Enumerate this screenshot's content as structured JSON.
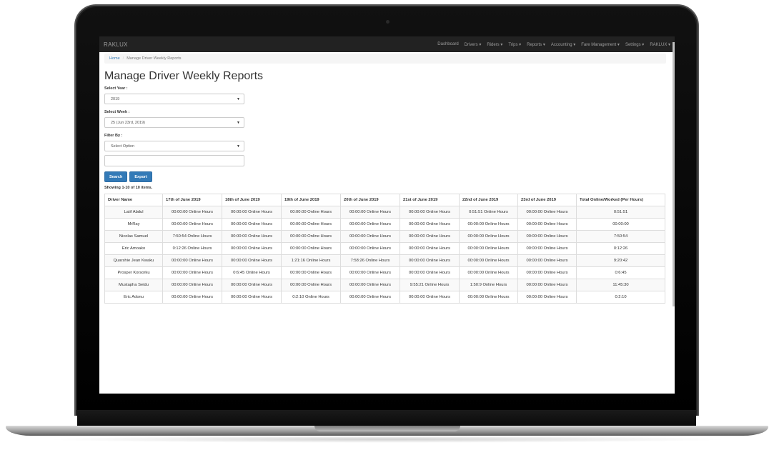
{
  "navbar": {
    "brand": "RAKLUX",
    "items": [
      "Dashboard",
      "Drivers ▾",
      "Riders ▾",
      "Trips ▾",
      "Reports ▾",
      "Accounting ▾",
      "Fare Management ▾",
      "Settings ▾",
      "RAKLUX ▾"
    ]
  },
  "breadcrumb": {
    "home": "Home",
    "separator": "/",
    "current": "Manage Driver Weekly Reports"
  },
  "page": {
    "title": "Manage Driver Weekly Reports"
  },
  "form": {
    "year_label": "Select Year :",
    "year_value": "2019",
    "week_label": "Select Week :",
    "week_value": "25 (Jun 23rd, 2019)",
    "filter_label": "Filter By :",
    "filter_value": "Select Option",
    "search_button": "Search",
    "export_button": "Export"
  },
  "summary": "Showing 1-10 of 10 items.",
  "table": {
    "headers": [
      "Driver Name",
      "17th of June 2019",
      "18th of June 2019",
      "19th of June 2019",
      "20th of June 2019",
      "21st of June 2019",
      "22nd of June 2019",
      "23rd of June 2019",
      "Total Online/Worked (Per Hours)"
    ],
    "rows": [
      [
        "Latif Abdul",
        "00:00:00 Online Hours",
        "00:00:00 Online Hours",
        "00:00:00 Online Hours",
        "00:00:00 Online Hours",
        "00:00:00 Online Hours",
        "0:51:51 Online Hours",
        "00:00:00 Online Hours",
        "0:51:51"
      ],
      [
        "MrRay",
        "00:00:00 Online Hours",
        "00:00:00 Online Hours",
        "00:00:00 Online Hours",
        "00:00:00 Online Hours",
        "00:00:00 Online Hours",
        "00:00:00 Online Hours",
        "00:00:00 Online Hours",
        "00:00:00"
      ],
      [
        "Nicolas Samuel",
        "7:50:54 Online Hours",
        "00:00:00 Online Hours",
        "00:00:00 Online Hours",
        "00:00:00 Online Hours",
        "00:00:00 Online Hours",
        "00:00:00 Online Hours",
        "00:00:00 Online Hours",
        "7:50:54"
      ],
      [
        "Eric Amoako",
        "0:12:26 Online Hours",
        "00:00:00 Online Hours",
        "00:00:00 Online Hours",
        "00:00:00 Online Hours",
        "00:00:00 Online Hours",
        "00:00:00 Online Hours",
        "00:00:00 Online Hours",
        "0:12:26"
      ],
      [
        "Quarshie Jean Kwaku",
        "00:00:00 Online Hours",
        "00:00:00 Online Hours",
        "1:21:16 Online Hours",
        "7:58:26 Online Hours",
        "00:00:00 Online Hours",
        "00:00:00 Online Hours",
        "00:00:00 Online Hours",
        "9:20:42"
      ],
      [
        "Prosper Korsorku",
        "00:00:00 Online Hours",
        "0:6:45 Online Hours",
        "00:00:00 Online Hours",
        "00:00:00 Online Hours",
        "00:00:00 Online Hours",
        "00:00:00 Online Hours",
        "00:00:00 Online Hours",
        "0:6:45"
      ],
      [
        "Mustapha Seidu",
        "00:00:00 Online Hours",
        "00:00:00 Online Hours",
        "00:00:00 Online Hours",
        "00:00:00 Online Hours",
        "9:55:21 Online Hours",
        "1:50:9 Online Hours",
        "00:00:00 Online Hours",
        "11:45:30"
      ],
      [
        "Eric Adonu",
        "00:00:00 Online Hours",
        "00:00:00 Online Hours",
        "0:2:10 Online Hours",
        "00:00:00 Online Hours",
        "00:00:00 Online Hours",
        "00:00:00 Online Hours",
        "00:00:00 Online Hours",
        "0:2:10"
      ]
    ]
  }
}
